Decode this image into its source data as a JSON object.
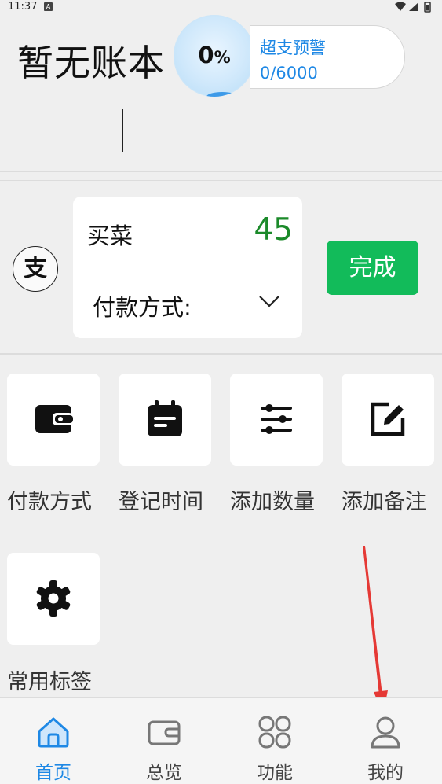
{
  "status_bar": {
    "time": "11:37",
    "notice_badge": "A"
  },
  "header": {
    "book_title": "暂无账本",
    "progress_value": "0",
    "progress_unit": "%",
    "budget_label": "超支预警",
    "budget_value": "0/6000"
  },
  "entry": {
    "type_badge": "支",
    "item_name": "买菜",
    "amount": "45",
    "payment_method_label": "付款方式:",
    "done_label": "完成"
  },
  "tiles": [
    {
      "label": "付款方式",
      "icon": "wallet-icon"
    },
    {
      "label": "登记时间",
      "icon": "calendar-icon"
    },
    {
      "label": "添加数量",
      "icon": "sliders-icon"
    },
    {
      "label": "添加备注",
      "icon": "edit-note-icon"
    },
    {
      "label": "常用标签",
      "icon": "gear-icon"
    }
  ],
  "bottom_nav": [
    {
      "label": "首页",
      "icon": "home-icon",
      "active": true
    },
    {
      "label": "总览",
      "icon": "wallet-outline-icon",
      "active": false
    },
    {
      "label": "功能",
      "icon": "grid-icon",
      "active": false
    },
    {
      "label": "我的",
      "icon": "person-icon",
      "active": false
    }
  ],
  "colors": {
    "accent_blue": "#1e88e5",
    "done_green": "#12bb5a",
    "amount_green": "#1b8a2a",
    "annotation_red": "#e53935"
  }
}
